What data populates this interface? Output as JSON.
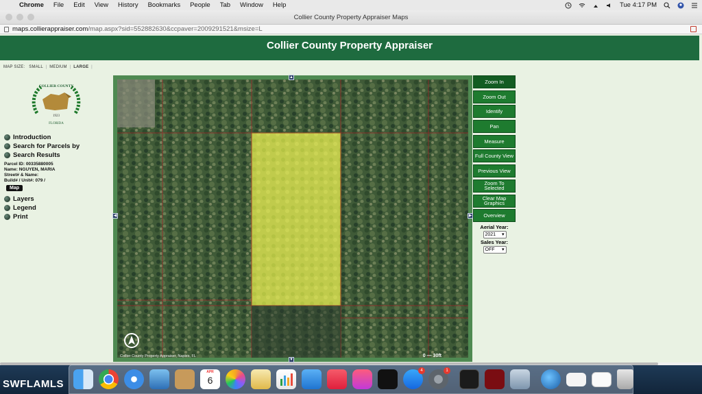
{
  "menubar": {
    "app": "Chrome",
    "items": [
      "File",
      "Edit",
      "View",
      "History",
      "Bookmarks",
      "People",
      "Tab",
      "Window",
      "Help"
    ],
    "clock": "Tue 4:17 PM"
  },
  "browser": {
    "title": "Collier County Property Appraiser Maps",
    "url_domain": "maps.collierappraiser.com",
    "url_path": "/map.aspx?sid=552882630&ccpaver=2009291521&msize=L"
  },
  "header": {
    "title": "Collier County Property Appraiser"
  },
  "map_size": {
    "label": "MAP SIZE:",
    "options": [
      "SMALL",
      "MEDIUM",
      "LARGE"
    ],
    "selected": "LARGE"
  },
  "seal": {
    "top": "COLLIER COUNTY",
    "year": "1923",
    "bottom": "FLORIDA"
  },
  "nav": {
    "items": [
      "Introduction",
      "Search for Parcels by",
      "Search Results"
    ],
    "more_items": [
      "Layers",
      "Legend",
      "Print"
    ]
  },
  "parcel": {
    "id_label": "Parcel ID:",
    "id": "00335880005",
    "name_label": "Name:",
    "name": "NGUYEN, MARIA",
    "street_label": "Street# & Name:",
    "street": "",
    "unit_label": "Build# / Unit#:",
    "unit": "079 /",
    "map_button": "Map"
  },
  "map": {
    "credit": "Collier County Property Appraiser, Naples, FL",
    "scale": "0 — 30ft"
  },
  "tools": {
    "buttons": [
      "Zoom In",
      "Zoom Out",
      "Identify",
      "Pan",
      "Measure",
      "Full County View",
      "Previous View",
      "Zoom To Selected",
      "Clear Map Graphics",
      "Overview"
    ],
    "aerial_label": "Aerial Year:",
    "aerial_value": "2021",
    "sales_label": "Sales Year:",
    "sales_value": "OFF"
  },
  "watermark": "SWFLAMLS",
  "dock": {
    "calendar_month": "APR",
    "calendar_day": "6",
    "appstore_badge": "4",
    "prefs_badge": "1"
  },
  "colors": {
    "header_green": "#1e6b3f",
    "button_green": "#1e7b2f",
    "parcel_highlight": "#e8e83c"
  }
}
